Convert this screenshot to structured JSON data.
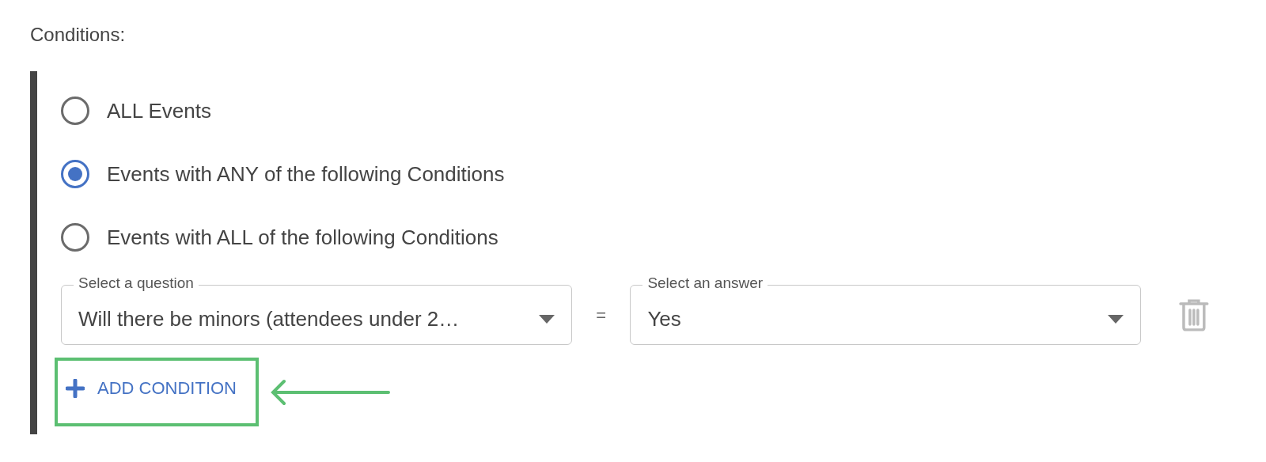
{
  "section_label": "Conditions:",
  "options": [
    {
      "label": "ALL Events",
      "selected": false
    },
    {
      "label": "Events with ANY of the following Conditions",
      "selected": true
    },
    {
      "label": "Events with ALL of the following Conditions",
      "selected": false
    }
  ],
  "condition": {
    "question": {
      "label": "Select a question",
      "value": "Will there be minors (attendees under 2…"
    },
    "operator": "=",
    "answer": {
      "label": "Select an answer",
      "value": "Yes"
    }
  },
  "add_button": {
    "label": "ADD CONDITION",
    "highlighted": true
  }
}
